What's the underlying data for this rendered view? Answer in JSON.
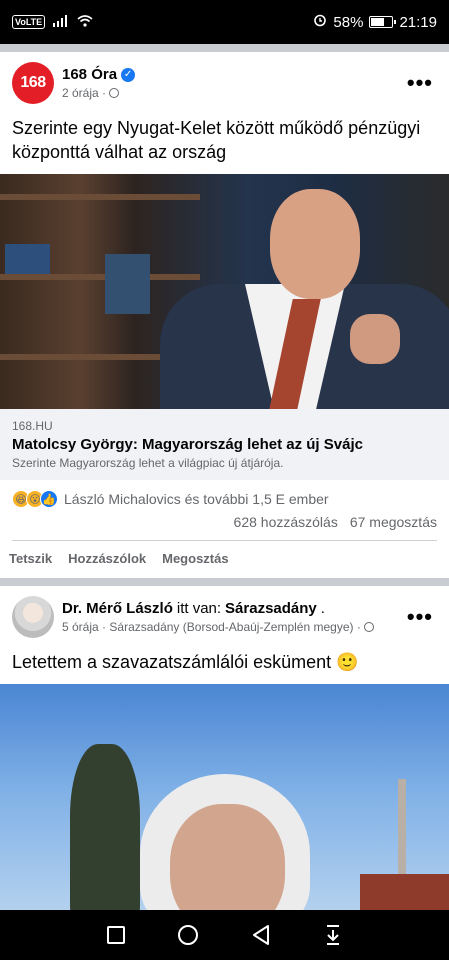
{
  "status_bar": {
    "network": "VoLTE",
    "battery": "58%",
    "battery_level": 0.58,
    "time": "21:19"
  },
  "posts": [
    {
      "avatar_text": "168",
      "author": "168 Óra",
      "time": "2 órája",
      "text": "Szerinte egy Nyugat-Kelet között működő pénzügyi központtá válhat az ország",
      "link": {
        "domain": "168.HU",
        "title": "Matolcsy György: Magyarország lehet az új Svájc",
        "description": "Szerinte Magyarország lehet a világpiac új átjárója."
      },
      "reactions_text": "László Michalovics és további 1,5 E ember",
      "comments": "628 hozzászólás",
      "shares": "67 megosztás",
      "actions": {
        "like": "Tetszik",
        "comment": "Hozzászólok",
        "share": "Megosztás"
      }
    },
    {
      "author": "Dr. Mérő László",
      "location_prefix": "itt van:",
      "location": "Sárazsadány",
      "period": ".",
      "time": "5 órája",
      "place_detail": "Sárazsadány (Borsod-Abaúj-Zemplén megye)",
      "text": "Letettem a szavazatszámlálói esküment 🙂"
    }
  ],
  "colors": {
    "facebook_blue": "#1877f2",
    "brand_168": "#e41e26",
    "secondary_text": "#65676b"
  }
}
